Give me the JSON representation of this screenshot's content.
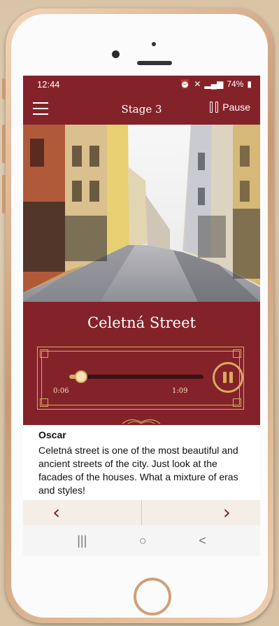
{
  "status_bar": {
    "time": "12:44",
    "battery": "74%"
  },
  "app_bar": {
    "stage_title": "Stage 3",
    "pause_label": "Pause"
  },
  "place": {
    "title": "Celetná Street"
  },
  "player": {
    "elapsed": "0:06",
    "duration": "1:09",
    "progress": 0.087
  },
  "transcript": {
    "speaker": "Oscar",
    "text": "Celetná street is one of the most beautiful and ancient streets of the city. Just look at the facades of the houses. What a mixture of eras and styles!"
  },
  "navigation": {
    "prev_icon": "chevron-left-icon",
    "next_icon": "chevron-right-icon"
  },
  "system_nav": {
    "recents": "|||",
    "home": "○",
    "back": "<"
  },
  "colors": {
    "brand": "#84222a",
    "gold": "#d8ab5f"
  }
}
